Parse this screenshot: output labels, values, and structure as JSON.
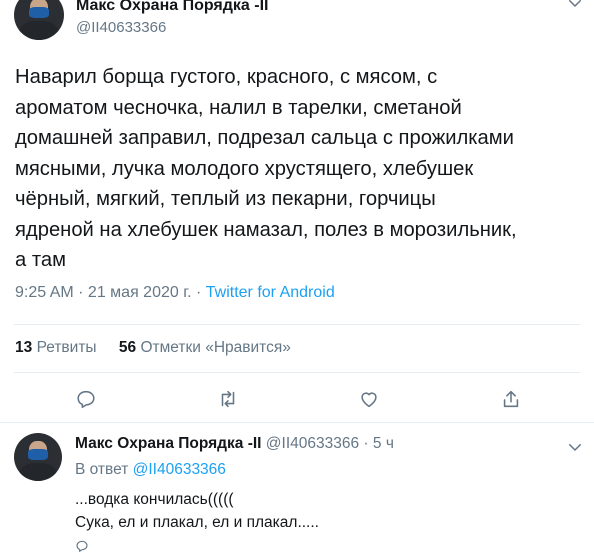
{
  "tweet": {
    "author_name": "Макс Охрана Порядка -II",
    "author_handle": "@II40633366",
    "text": "Наварил борща густого, красного, с мясом, с\nароматом чесночка, налил в тарелки, сметаной\nдомашней заправил, подрезал сальца с прожилками\nмясными, лучка молодого хрустящего, хлебушек\nчёрный, мягкий, теплый из пекарни, горчицы\nядреной на хлебушек намазал, полез в морозильник,\nа там",
    "time": "9:25 AM",
    "separator": " · ",
    "date": "21 мая 2020 г.",
    "source": "Twitter for Android",
    "retweets_count": "13",
    "retweets_label": "Ретвиты",
    "likes_count": "56",
    "likes_label": "Отметки «Нравится»"
  },
  "actions": {
    "icons": [
      "reply-icon",
      "retweet-icon",
      "like-icon",
      "share-icon"
    ]
  },
  "reply": {
    "author_name": "Макс Охрана Порядка -II",
    "author_handle": "@II40633366",
    "time_sep": " · ",
    "time": "5 ч",
    "reply_prefix": "В ответ",
    "reply_to": "@II40633366",
    "text": "...водка кончилась(((((\nСука, ел и плакал, ел и плакал....."
  },
  "colors": {
    "accent": "#1da1f2",
    "muted": "#657786",
    "text": "#14171a",
    "divider": "#e6ecf0"
  }
}
